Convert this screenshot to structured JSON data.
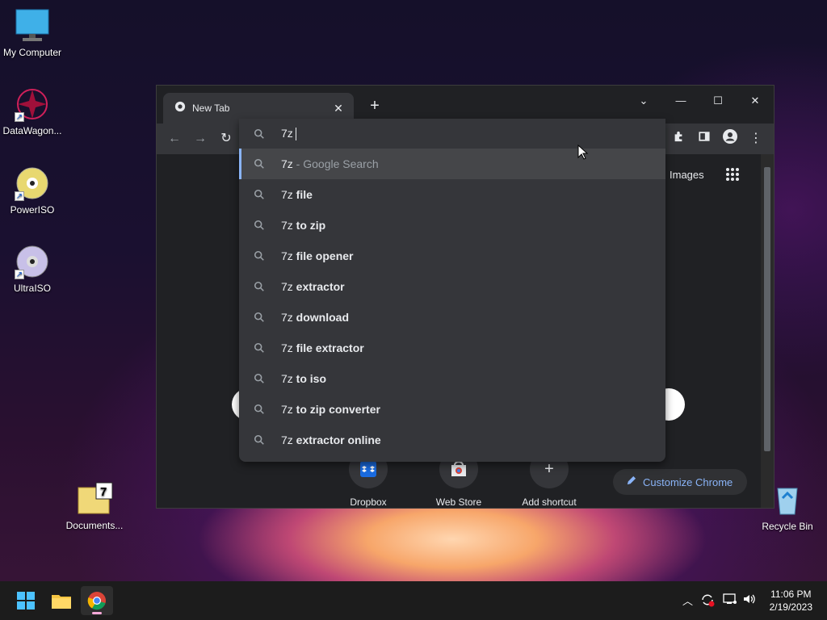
{
  "desktop": {
    "icons": [
      {
        "label": "My Computer"
      },
      {
        "label": "DataWagon..."
      },
      {
        "label": "PowerISO"
      },
      {
        "label": "UltraISO"
      },
      {
        "label": "Documents..."
      },
      {
        "label": "Recycle Bin"
      }
    ]
  },
  "browser": {
    "tab_title": "New Tab",
    "omnibox": {
      "query": "7z",
      "suggestions": [
        {
          "prefix": "7z",
          "rest": "",
          "suffix": " - Google Search"
        },
        {
          "prefix": "7z",
          "rest": " file",
          "suffix": ""
        },
        {
          "prefix": "7z",
          "rest": " to zip",
          "suffix": ""
        },
        {
          "prefix": "7z",
          "rest": " file opener",
          "suffix": ""
        },
        {
          "prefix": "7z",
          "rest": " extractor",
          "suffix": ""
        },
        {
          "prefix": "7z",
          "rest": " download",
          "suffix": ""
        },
        {
          "prefix": "7z",
          "rest": " file extractor",
          "suffix": ""
        },
        {
          "prefix": "7z",
          "rest": " to iso",
          "suffix": ""
        },
        {
          "prefix": "7z",
          "rest": " to zip converter",
          "suffix": ""
        },
        {
          "prefix": "7z",
          "rest": " extractor online",
          "suffix": ""
        }
      ]
    },
    "ntp": {
      "images_link": "Images",
      "shortcuts": [
        {
          "label": "Dropbox"
        },
        {
          "label": "Web Store"
        },
        {
          "label": "Add shortcut"
        }
      ],
      "customize_label": "Customize Chrome"
    }
  },
  "taskbar": {
    "time": "11:06 PM",
    "date": "2/19/2023"
  },
  "colors": {
    "accent": "#8ab4f8",
    "window_bg": "#202124",
    "omnibox_bg": "#35363a"
  }
}
